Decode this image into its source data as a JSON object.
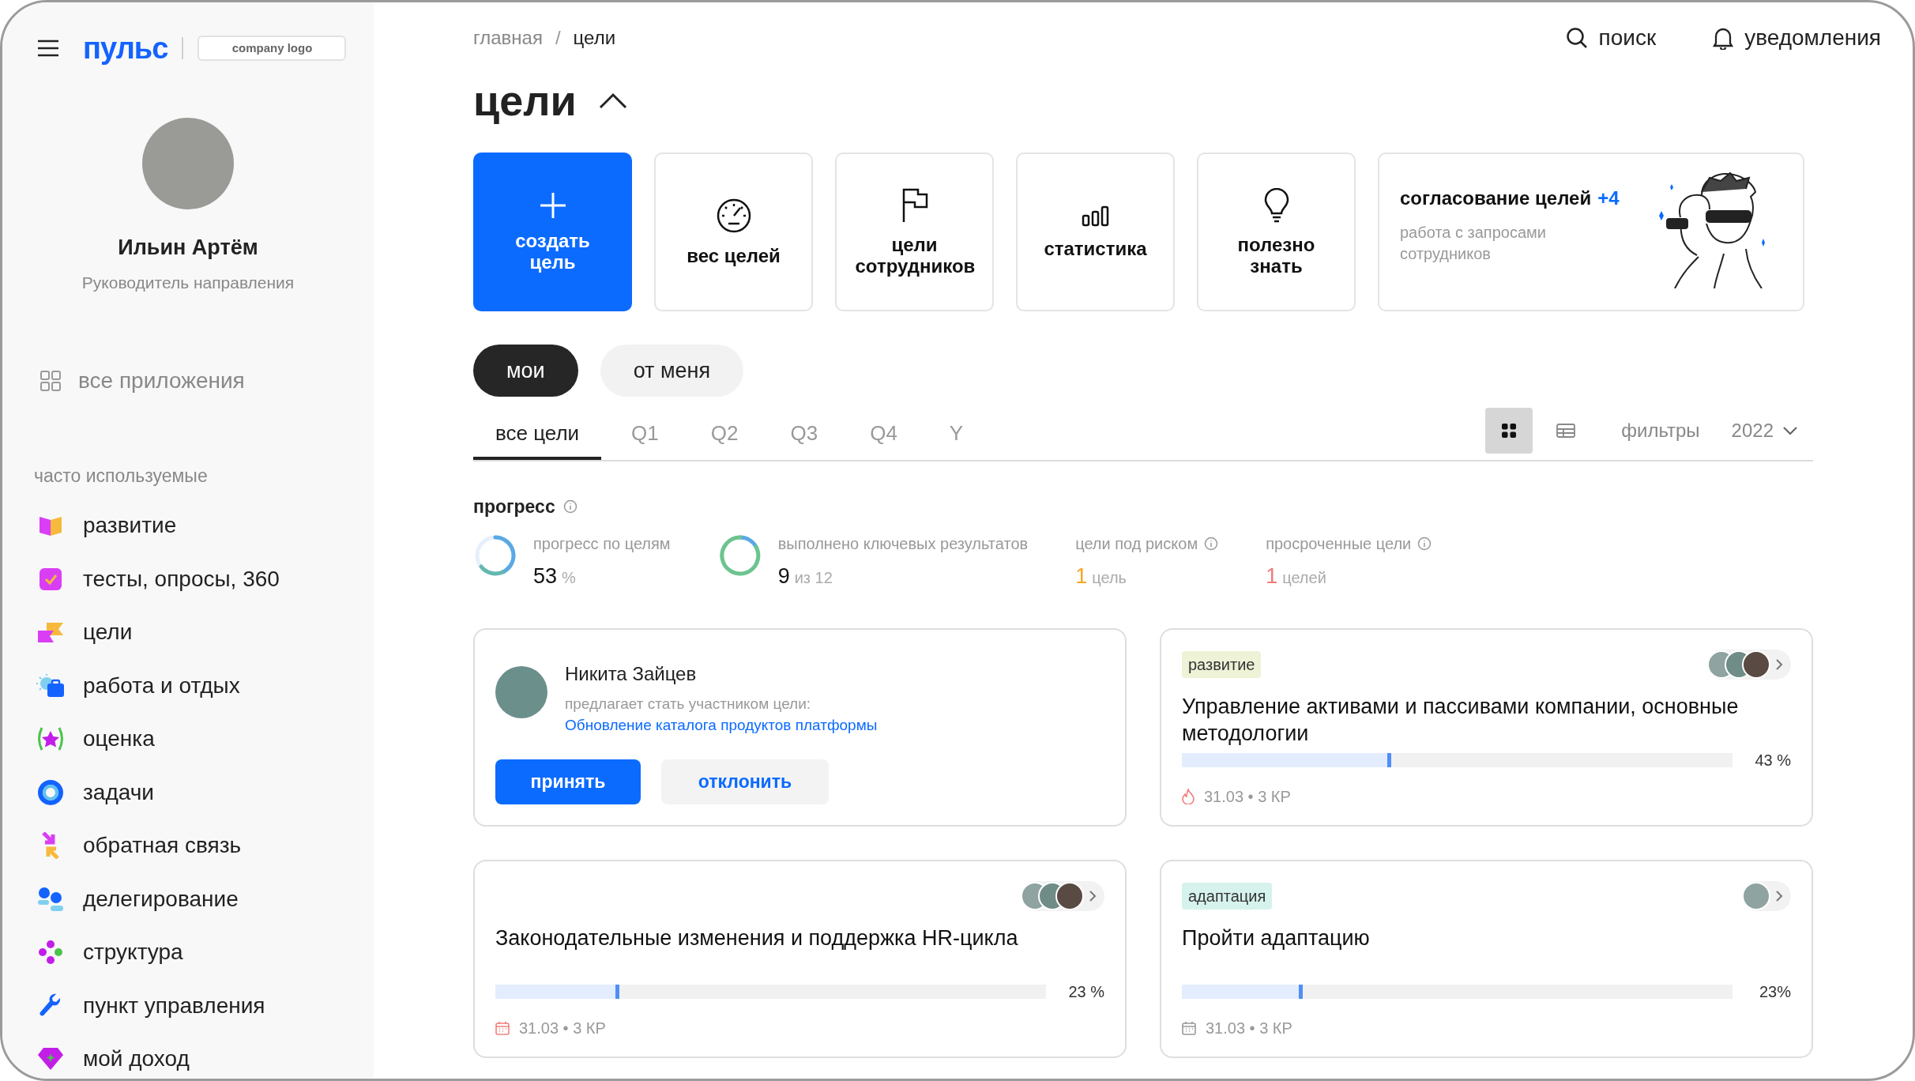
{
  "sidebar": {
    "logo": "пульс",
    "company_logo": "company logo",
    "profile": {
      "name": "Ильин Артём",
      "role": "Руководитель направления"
    },
    "all_apps": "все приложения",
    "section_title": "часто используемые",
    "items": [
      {
        "label": "развитие"
      },
      {
        "label": "тесты, опросы, 360"
      },
      {
        "label": "цели"
      },
      {
        "label": "работа и отдых"
      },
      {
        "label": "оценка"
      },
      {
        "label": "задачи"
      },
      {
        "label": "обратная связь"
      },
      {
        "label": "делегирование"
      },
      {
        "label": "структура"
      },
      {
        "label": "пункт управления"
      },
      {
        "label": "мой доход"
      }
    ]
  },
  "header": {
    "breadcrumbs": [
      "главная",
      "цели"
    ],
    "separator": "/",
    "search": "поиск",
    "notifications": "уведомления"
  },
  "page": {
    "title": "цели",
    "expanded": true
  },
  "actions": [
    {
      "kind": "primary",
      "label": "создать цель"
    },
    {
      "kind": "tile",
      "label": "вес целей"
    },
    {
      "kind": "tile",
      "label": "цели сотрудников"
    },
    {
      "kind": "tile",
      "label": "статистика"
    },
    {
      "kind": "tile",
      "label": "полезно знать"
    },
    {
      "kind": "banner",
      "label": "согласование целей",
      "count": "+4",
      "subtitle": "работа с запросами сотрудников"
    }
  ],
  "owner_tabs": [
    {
      "label": "мои",
      "selected": true
    },
    {
      "label": "от меня",
      "selected": false
    }
  ],
  "period_tabs": [
    {
      "label": "все цели",
      "selected": true
    },
    {
      "label": "Q1",
      "selected": false
    },
    {
      "label": "Q2",
      "selected": false
    },
    {
      "label": "Q3",
      "selected": false
    },
    {
      "label": "Q4",
      "selected": false
    },
    {
      "label": "Y",
      "selected": false
    }
  ],
  "view_toggle": [
    {
      "kind": "grid",
      "selected": true
    },
    {
      "kind": "table",
      "selected": false
    }
  ],
  "filters": "фильтры",
  "year": "2022",
  "progress": {
    "title": "прогресс",
    "stats": [
      {
        "kind": "ring",
        "label": "прогресс по целям",
        "value": "53",
        "unit": "%",
        "info": false,
        "color": "#111111"
      },
      {
        "kind": "ring",
        "label": "выполнено ключевых результатов",
        "value": "9",
        "unit": "из 12",
        "info": false,
        "color": "#111111"
      },
      {
        "kind": "count",
        "label": "цели под риском",
        "value": "1",
        "unit": "цель",
        "info": true,
        "color": "#f5a623"
      },
      {
        "kind": "count",
        "label": "просроченные цели",
        "value": "1",
        "unit": "целей",
        "info": true,
        "color": "#f07a7a"
      }
    ]
  },
  "cards": [
    {
      "kind": "invite",
      "name": "Никита Зайцев",
      "text": "предлагает стать участником цели:",
      "link": "Обновление каталога продуктов платформы",
      "accept": "принять",
      "decline": "отклонить"
    },
    {
      "kind": "goal",
      "tag": {
        "label": "развитие",
        "color": "#eef2d6"
      },
      "avatars": [
        {
          "kind": "photo"
        },
        {
          "kind": "photo"
        },
        {
          "kind": "photo"
        }
      ],
      "title": "Управление активами и пассивами компании, основные методологии",
      "level": 0.38,
      "percent": "43 %",
      "date": {
        "kind": "fire",
        "overdue": true,
        "text": "31.03 • 3 КР"
      }
    },
    {
      "kind": "goal",
      "avatars": [
        {
          "kind": "photo"
        },
        {
          "kind": "photo"
        },
        {
          "kind": "photo"
        }
      ],
      "title": "Законодательные изменения и поддержка HR-цикла",
      "level": 0.225,
      "percent": "23 %",
      "date": {
        "kind": "calendar",
        "overdue": true,
        "text": "31.03 • 3 КР"
      }
    },
    {
      "kind": "goal",
      "tag": {
        "label": "адаптация",
        "color": "#d6f2ec"
      },
      "avatars": [
        {
          "kind": "photo"
        }
      ],
      "title": "Пройти адаптацию",
      "level": 0.22,
      "percent": "23%",
      "date": {
        "kind": "calendar",
        "overdue": false,
        "text": "31.03 • 3 КР"
      }
    }
  ]
}
